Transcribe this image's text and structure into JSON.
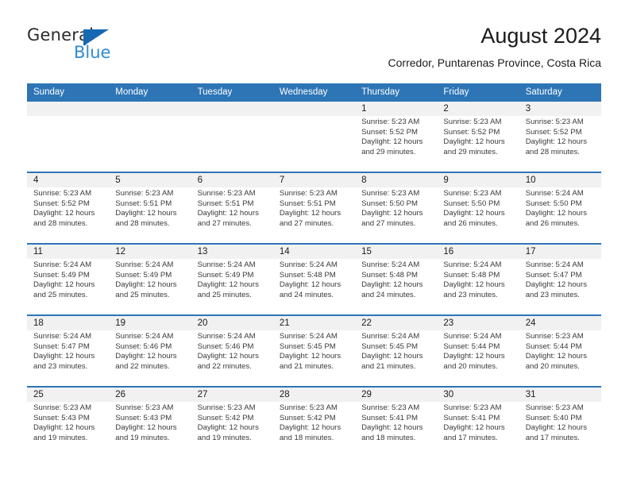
{
  "brand": {
    "name_part1": "General",
    "name_part2": "Blue",
    "flag_icon": "brand-flag-icon",
    "accent_color": "#1668B3",
    "blue_text_color": "#2E8BD4"
  },
  "header": {
    "title": "August 2024",
    "subtitle": "Corredor, Puntarenas Province, Costa Rica"
  },
  "calendar": {
    "header_bg_color": "#2E75B6",
    "date_band_color": "#F1F1F1",
    "weekday_headers": [
      "Sunday",
      "Monday",
      "Tuesday",
      "Wednesday",
      "Thursday",
      "Friday",
      "Saturday"
    ],
    "weeks": [
      [
        {
          "day": "",
          "empty": true,
          "sunrise": "",
          "sunset": "",
          "daylight_line1": "",
          "daylight_line2": ""
        },
        {
          "day": "",
          "empty": true,
          "sunrise": "",
          "sunset": "",
          "daylight_line1": "",
          "daylight_line2": ""
        },
        {
          "day": "",
          "empty": true,
          "sunrise": "",
          "sunset": "",
          "daylight_line1": "",
          "daylight_line2": ""
        },
        {
          "day": "",
          "empty": true,
          "sunrise": "",
          "sunset": "",
          "daylight_line1": "",
          "daylight_line2": ""
        },
        {
          "day": "1",
          "empty": false,
          "sunrise": "Sunrise: 5:23 AM",
          "sunset": "Sunset: 5:52 PM",
          "daylight_line1": "Daylight: 12 hours",
          "daylight_line2": "and 29 minutes."
        },
        {
          "day": "2",
          "empty": false,
          "sunrise": "Sunrise: 5:23 AM",
          "sunset": "Sunset: 5:52 PM",
          "daylight_line1": "Daylight: 12 hours",
          "daylight_line2": "and 29 minutes."
        },
        {
          "day": "3",
          "empty": false,
          "sunrise": "Sunrise: 5:23 AM",
          "sunset": "Sunset: 5:52 PM",
          "daylight_line1": "Daylight: 12 hours",
          "daylight_line2": "and 28 minutes."
        }
      ],
      [
        {
          "day": "4",
          "empty": false,
          "sunrise": "Sunrise: 5:23 AM",
          "sunset": "Sunset: 5:52 PM",
          "daylight_line1": "Daylight: 12 hours",
          "daylight_line2": "and 28 minutes."
        },
        {
          "day": "5",
          "empty": false,
          "sunrise": "Sunrise: 5:23 AM",
          "sunset": "Sunset: 5:51 PM",
          "daylight_line1": "Daylight: 12 hours",
          "daylight_line2": "and 28 minutes."
        },
        {
          "day": "6",
          "empty": false,
          "sunrise": "Sunrise: 5:23 AM",
          "sunset": "Sunset: 5:51 PM",
          "daylight_line1": "Daylight: 12 hours",
          "daylight_line2": "and 27 minutes."
        },
        {
          "day": "7",
          "empty": false,
          "sunrise": "Sunrise: 5:23 AM",
          "sunset": "Sunset: 5:51 PM",
          "daylight_line1": "Daylight: 12 hours",
          "daylight_line2": "and 27 minutes."
        },
        {
          "day": "8",
          "empty": false,
          "sunrise": "Sunrise: 5:23 AM",
          "sunset": "Sunset: 5:50 PM",
          "daylight_line1": "Daylight: 12 hours",
          "daylight_line2": "and 27 minutes."
        },
        {
          "day": "9",
          "empty": false,
          "sunrise": "Sunrise: 5:23 AM",
          "sunset": "Sunset: 5:50 PM",
          "daylight_line1": "Daylight: 12 hours",
          "daylight_line2": "and 26 minutes."
        },
        {
          "day": "10",
          "empty": false,
          "sunrise": "Sunrise: 5:24 AM",
          "sunset": "Sunset: 5:50 PM",
          "daylight_line1": "Daylight: 12 hours",
          "daylight_line2": "and 26 minutes."
        }
      ],
      [
        {
          "day": "11",
          "empty": false,
          "sunrise": "Sunrise: 5:24 AM",
          "sunset": "Sunset: 5:49 PM",
          "daylight_line1": "Daylight: 12 hours",
          "daylight_line2": "and 25 minutes."
        },
        {
          "day": "12",
          "empty": false,
          "sunrise": "Sunrise: 5:24 AM",
          "sunset": "Sunset: 5:49 PM",
          "daylight_line1": "Daylight: 12 hours",
          "daylight_line2": "and 25 minutes."
        },
        {
          "day": "13",
          "empty": false,
          "sunrise": "Sunrise: 5:24 AM",
          "sunset": "Sunset: 5:49 PM",
          "daylight_line1": "Daylight: 12 hours",
          "daylight_line2": "and 25 minutes."
        },
        {
          "day": "14",
          "empty": false,
          "sunrise": "Sunrise: 5:24 AM",
          "sunset": "Sunset: 5:48 PM",
          "daylight_line1": "Daylight: 12 hours",
          "daylight_line2": "and 24 minutes."
        },
        {
          "day": "15",
          "empty": false,
          "sunrise": "Sunrise: 5:24 AM",
          "sunset": "Sunset: 5:48 PM",
          "daylight_line1": "Daylight: 12 hours",
          "daylight_line2": "and 24 minutes."
        },
        {
          "day": "16",
          "empty": false,
          "sunrise": "Sunrise: 5:24 AM",
          "sunset": "Sunset: 5:48 PM",
          "daylight_line1": "Daylight: 12 hours",
          "daylight_line2": "and 23 minutes."
        },
        {
          "day": "17",
          "empty": false,
          "sunrise": "Sunrise: 5:24 AM",
          "sunset": "Sunset: 5:47 PM",
          "daylight_line1": "Daylight: 12 hours",
          "daylight_line2": "and 23 minutes."
        }
      ],
      [
        {
          "day": "18",
          "empty": false,
          "sunrise": "Sunrise: 5:24 AM",
          "sunset": "Sunset: 5:47 PM",
          "daylight_line1": "Daylight: 12 hours",
          "daylight_line2": "and 23 minutes."
        },
        {
          "day": "19",
          "empty": false,
          "sunrise": "Sunrise: 5:24 AM",
          "sunset": "Sunset: 5:46 PM",
          "daylight_line1": "Daylight: 12 hours",
          "daylight_line2": "and 22 minutes."
        },
        {
          "day": "20",
          "empty": false,
          "sunrise": "Sunrise: 5:24 AM",
          "sunset": "Sunset: 5:46 PM",
          "daylight_line1": "Daylight: 12 hours",
          "daylight_line2": "and 22 minutes."
        },
        {
          "day": "21",
          "empty": false,
          "sunrise": "Sunrise: 5:24 AM",
          "sunset": "Sunset: 5:45 PM",
          "daylight_line1": "Daylight: 12 hours",
          "daylight_line2": "and 21 minutes."
        },
        {
          "day": "22",
          "empty": false,
          "sunrise": "Sunrise: 5:24 AM",
          "sunset": "Sunset: 5:45 PM",
          "daylight_line1": "Daylight: 12 hours",
          "daylight_line2": "and 21 minutes."
        },
        {
          "day": "23",
          "empty": false,
          "sunrise": "Sunrise: 5:24 AM",
          "sunset": "Sunset: 5:44 PM",
          "daylight_line1": "Daylight: 12 hours",
          "daylight_line2": "and 20 minutes."
        },
        {
          "day": "24",
          "empty": false,
          "sunrise": "Sunrise: 5:23 AM",
          "sunset": "Sunset: 5:44 PM",
          "daylight_line1": "Daylight: 12 hours",
          "daylight_line2": "and 20 minutes."
        }
      ],
      [
        {
          "day": "25",
          "empty": false,
          "sunrise": "Sunrise: 5:23 AM",
          "sunset": "Sunset: 5:43 PM",
          "daylight_line1": "Daylight: 12 hours",
          "daylight_line2": "and 19 minutes."
        },
        {
          "day": "26",
          "empty": false,
          "sunrise": "Sunrise: 5:23 AM",
          "sunset": "Sunset: 5:43 PM",
          "daylight_line1": "Daylight: 12 hours",
          "daylight_line2": "and 19 minutes."
        },
        {
          "day": "27",
          "empty": false,
          "sunrise": "Sunrise: 5:23 AM",
          "sunset": "Sunset: 5:42 PM",
          "daylight_line1": "Daylight: 12 hours",
          "daylight_line2": "and 19 minutes."
        },
        {
          "day": "28",
          "empty": false,
          "sunrise": "Sunrise: 5:23 AM",
          "sunset": "Sunset: 5:42 PM",
          "daylight_line1": "Daylight: 12 hours",
          "daylight_line2": "and 18 minutes."
        },
        {
          "day": "29",
          "empty": false,
          "sunrise": "Sunrise: 5:23 AM",
          "sunset": "Sunset: 5:41 PM",
          "daylight_line1": "Daylight: 12 hours",
          "daylight_line2": "and 18 minutes."
        },
        {
          "day": "30",
          "empty": false,
          "sunrise": "Sunrise: 5:23 AM",
          "sunset": "Sunset: 5:41 PM",
          "daylight_line1": "Daylight: 12 hours",
          "daylight_line2": "and 17 minutes."
        },
        {
          "day": "31",
          "empty": false,
          "sunrise": "Sunrise: 5:23 AM",
          "sunset": "Sunset: 5:40 PM",
          "daylight_line1": "Daylight: 12 hours",
          "daylight_line2": "and 17 minutes."
        }
      ]
    ]
  }
}
